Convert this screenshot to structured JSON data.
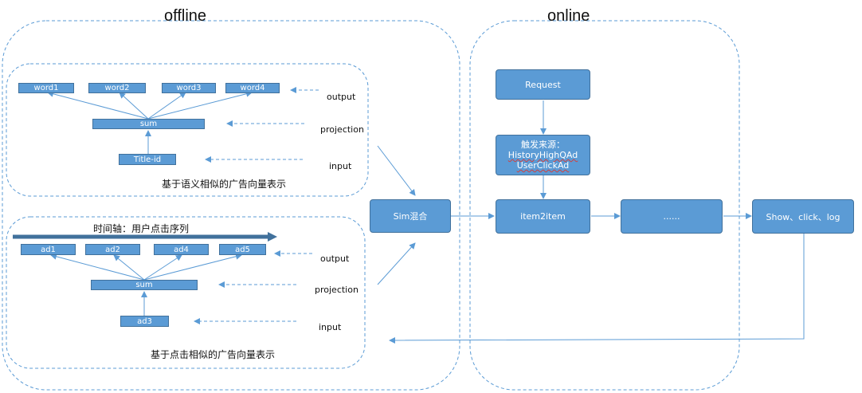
{
  "sections": {
    "offline_title": "offline",
    "online_title": "online"
  },
  "word_group": {
    "words": [
      "word1",
      "word2",
      "word3",
      "word4"
    ],
    "sum": "sum",
    "input_node": "Title-id",
    "output_label": "output",
    "projection_label": "projection",
    "input_label": "input",
    "caption": "基于语义相似的广告向量表示"
  },
  "ad_group": {
    "timeline_label": "时间轴：用户点击序列",
    "ads": [
      "ad1",
      "ad2",
      "ad4",
      "ad5"
    ],
    "sum": "sum",
    "input_node": "ad3",
    "output_label": "output",
    "projection_label": "projection",
    "input_label": "input",
    "caption": "基于点击相似的广告向量表示"
  },
  "sim_node": "Sim混合",
  "online": {
    "request": "Request",
    "trigger_title": "触发来源：",
    "trigger_line1": "HistoryHighQAd",
    "trigger_line2": "UserClickAd",
    "item2item": "item2item",
    "next": "......",
    "log": "Show、click、log"
  },
  "colors": {
    "box_fill": "#5b9bd5",
    "box_border": "#41719c",
    "arrow": "#5b9bd5"
  }
}
